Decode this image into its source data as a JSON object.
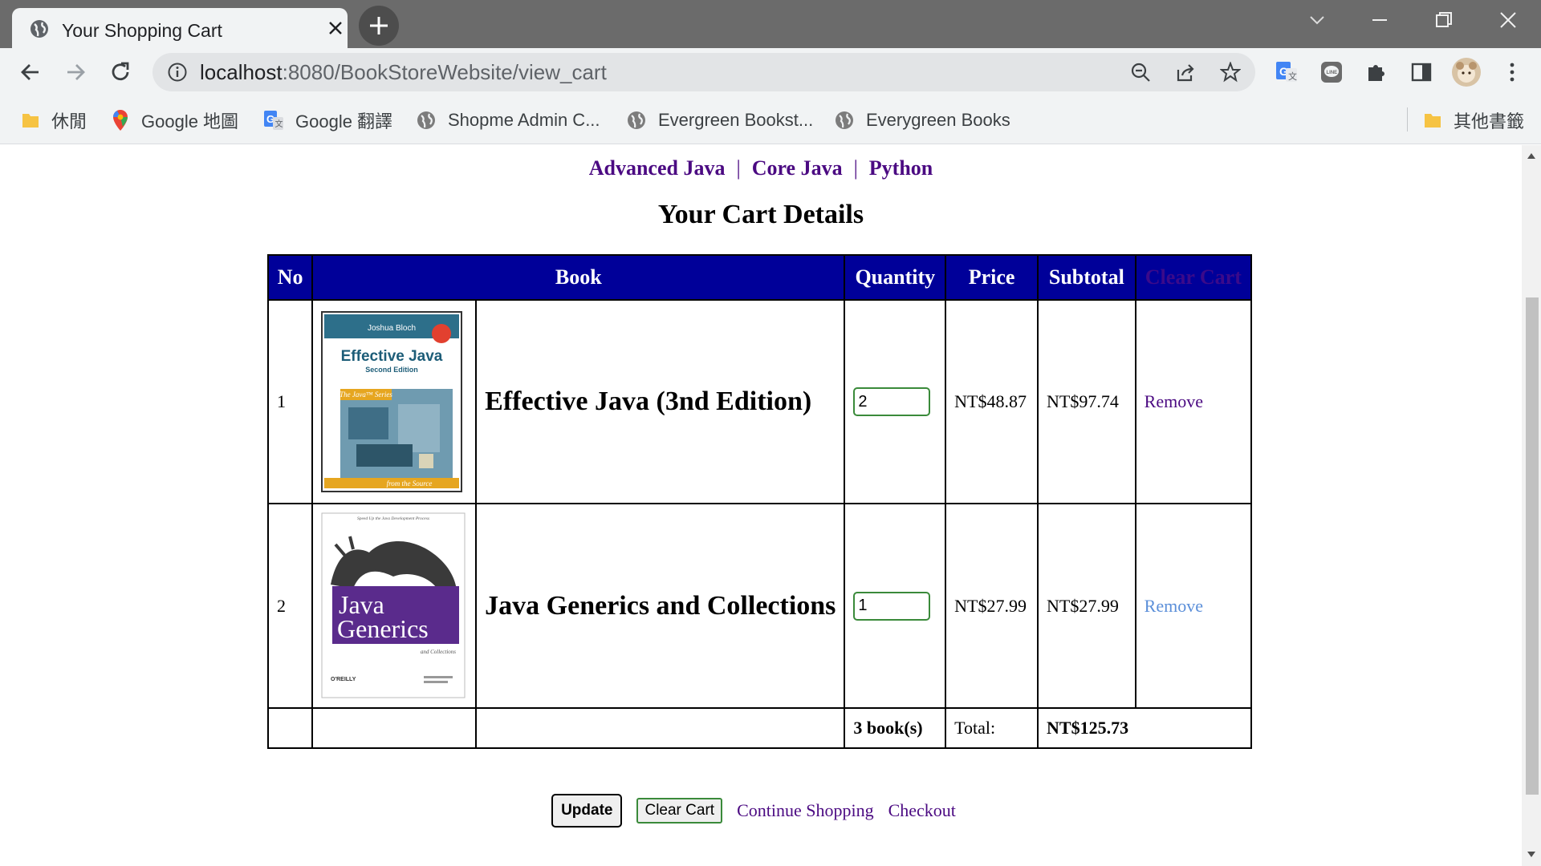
{
  "browser": {
    "tab_title": "Your Shopping Cart",
    "url_host": "localhost",
    "url_rest": ":8080/BookStoreWebsite/view_cart",
    "bookmarks": [
      {
        "label": "休閒",
        "icon": "folder-icon"
      },
      {
        "label": "Google 地圖",
        "icon": "google-maps-icon"
      },
      {
        "label": "Google 翻譯",
        "icon": "google-translate-icon"
      },
      {
        "label": "Shopme Admin C...",
        "icon": "globe-icon"
      },
      {
        "label": "Evergreen Bookst...",
        "icon": "globe-icon"
      },
      {
        "label": "Everygreen Books",
        "icon": "globe-icon"
      }
    ],
    "other_bookmarks": "其他書籤"
  },
  "nav": {
    "categories": [
      "Advanced Java",
      "Core Java",
      "Python"
    ],
    "separator": "|"
  },
  "page": {
    "title": "Your Cart Details"
  },
  "cart": {
    "headers": {
      "no": "No",
      "book": "Book",
      "quantity": "Quantity",
      "price": "Price",
      "subtotal": "Subtotal",
      "clear": "Clear Cart"
    },
    "items": [
      {
        "no": "1",
        "cover_top": "Joshua Bloch",
        "cover_title": "Effective Java",
        "cover_sub": "Second Edition",
        "cover_series": "The Java™ Series",
        "cover_bottom": "from the Source",
        "title": "Effective Java (3nd Edition)",
        "quantity": "2",
        "price": "NT$48.87",
        "subtotal": "NT$97.74",
        "remove": "Remove"
      },
      {
        "no": "2",
        "cover_top": "Speed Up the Java Development Process",
        "cover_title_1": "Java",
        "cover_title_2": "Generics",
        "cover_sub": "and Collections",
        "cover_publisher": "O'REILLY",
        "title": "Java Generics and Collections",
        "quantity": "1",
        "price": "NT$27.99",
        "subtotal": "NT$27.99",
        "remove": "Remove"
      }
    ],
    "total_books": "3 book(s)",
    "total_label": "Total:",
    "total_value": "NT$125.73"
  },
  "actions": {
    "update": "Update",
    "clear_cart": "Clear Cart",
    "continue": "Continue Shopping",
    "checkout": "Checkout"
  },
  "colors": {
    "header_bg": "#000099",
    "link": "#4b0a82",
    "visited_link": "#5b8fd9"
  }
}
